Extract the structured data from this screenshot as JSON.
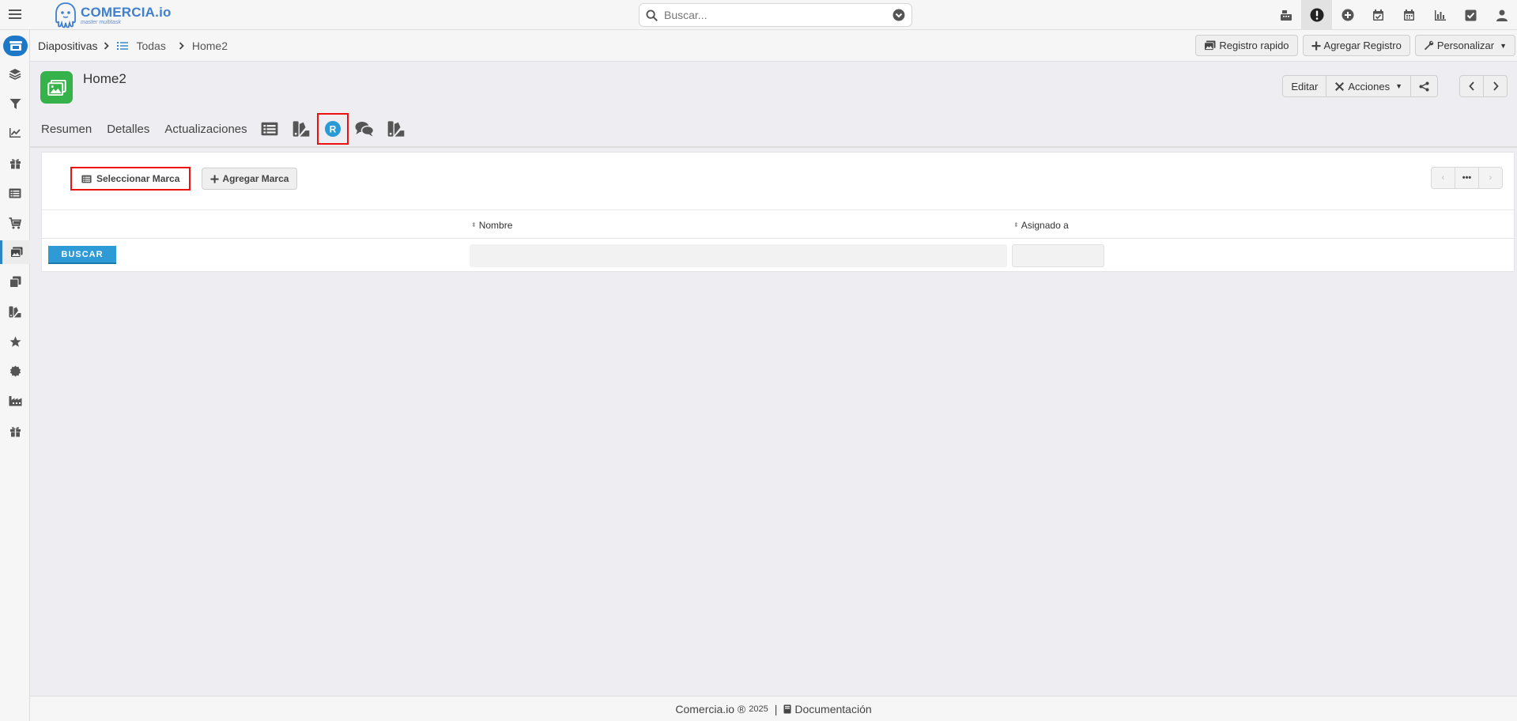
{
  "app": {
    "logo_name": "COMERCIA.io",
    "logo_tagline": "master multitask",
    "brand_color": "#3f7fd0"
  },
  "search": {
    "placeholder": "Buscar..."
  },
  "top_icons": [
    "cash-register-icon",
    "alert-icon",
    "plus-circle-icon",
    "calendar-check-icon",
    "calendar-icon",
    "bar-chart-icon",
    "checkbox-icon",
    "user-icon"
  ],
  "sidebar": {
    "items": [
      "home-store-icon",
      "layers-icon",
      "filter-icon",
      "chart-icon",
      "gift-icon",
      "list-icon",
      "cart-icon",
      "slides-icon",
      "copy-icon",
      "brands-icon",
      "star-icon",
      "badge-icon",
      "industry-icon",
      "gift-icon"
    ],
    "active": "slides-icon"
  },
  "breadcrumb": {
    "module": "Diapositivas",
    "list": "Todas",
    "record": "Home2"
  },
  "toolbar": {
    "quick": "Registro rapido",
    "add": "Agregar Registro",
    "customize": "Personalizar"
  },
  "record": {
    "title": "Home2",
    "edit": "Editar",
    "actions": "Acciones"
  },
  "tabs": {
    "summary": "Resumen",
    "details": "Detalles",
    "updates": "Actualizaciones",
    "icon_tabs": [
      "list-icon",
      "brands-icon",
      "registered-icon",
      "comments-icon",
      "brands-icon"
    ],
    "active_icon_tab": "registered-icon"
  },
  "subpanel": {
    "select_label": "Seleccionar Marca",
    "add_label": "Agregar Marca",
    "columns": [
      "Nombre",
      "Asignado a"
    ],
    "search_button": "BUSCAR",
    "rows": []
  },
  "footer": {
    "brand": "Comercia.io ®",
    "year": "2025",
    "separator": "|",
    "docs": "Documentación"
  },
  "colors": {
    "highlight": "#ee1111",
    "primary_button": "#2f9bd6",
    "record_avatar": "#36b24a"
  }
}
